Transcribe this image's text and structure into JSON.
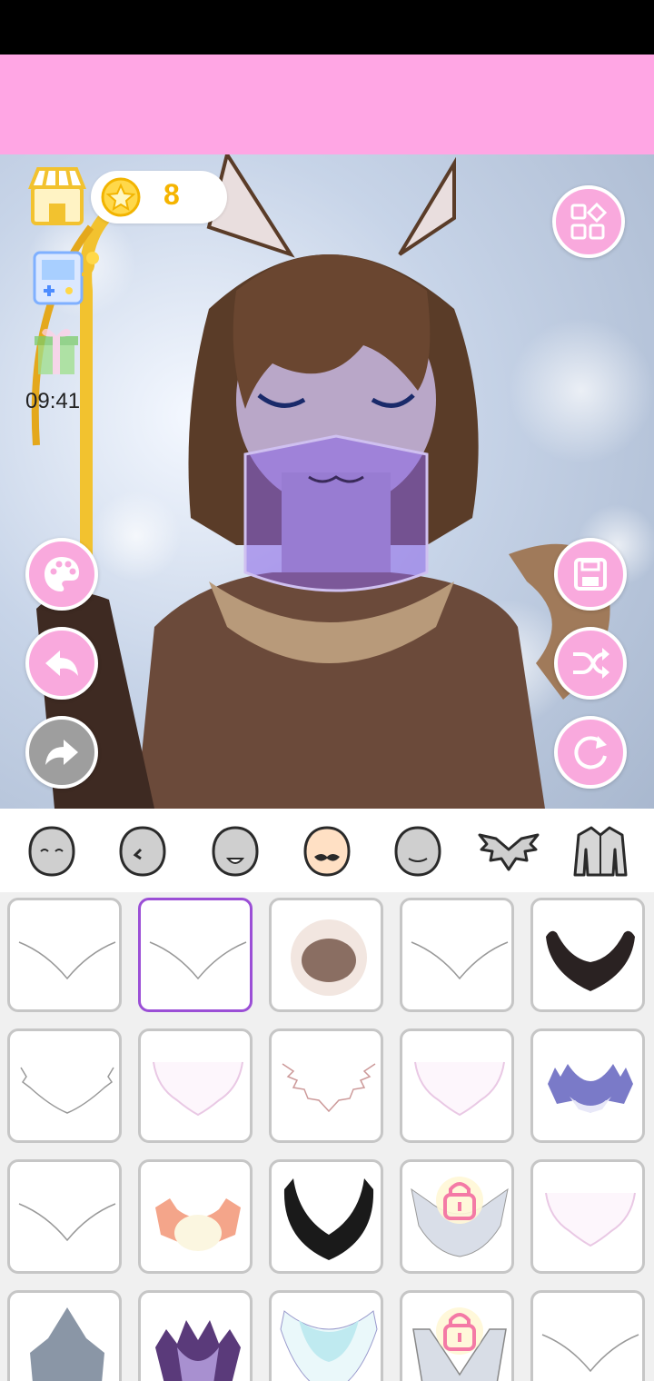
{
  "hud": {
    "coins": "8",
    "timer": "09:41"
  },
  "colors": {
    "banner": "#ffa6e4",
    "button_pink": "#f9a9dd",
    "button_disabled": "#9e9e9e",
    "selected_border": "#9b4fd6",
    "coin_text": "#f5b400"
  },
  "icons": {
    "shop": "shop-icon",
    "coin": "coin-icon",
    "game": "game-console-icon",
    "gift": "gift-icon",
    "menu": "grid-menu-icon",
    "palette": "palette-icon",
    "undo": "undo-icon",
    "redo": "redo-icon",
    "save": "save-icon",
    "shuffle": "shuffle-icon",
    "reset": "reset-icon"
  },
  "category_tabs": [
    {
      "id": "face",
      "icon": "face-icon",
      "selected": false
    },
    {
      "id": "ear",
      "icon": "ear-icon",
      "selected": false
    },
    {
      "id": "mouth",
      "icon": "mouth-icon",
      "selected": false
    },
    {
      "id": "mustache",
      "icon": "mustache-icon",
      "selected": true
    },
    {
      "id": "head",
      "icon": "head-icon",
      "selected": false
    },
    {
      "id": "fur-collar",
      "icon": "fur-collar-icon",
      "selected": false
    },
    {
      "id": "clothing",
      "icon": "jacket-icon",
      "selected": false
    }
  ],
  "items": [
    {
      "type": "outline",
      "locked": false,
      "selected": false
    },
    {
      "type": "outline",
      "locked": false,
      "selected": true
    },
    {
      "type": "brown-fluff",
      "locked": false,
      "selected": false
    },
    {
      "type": "outline",
      "locked": false,
      "selected": false
    },
    {
      "type": "black-fur",
      "locked": false,
      "selected": false
    },
    {
      "type": "outline-fluffy",
      "locked": false,
      "selected": false
    },
    {
      "type": "pink-outline",
      "locked": false,
      "selected": false
    },
    {
      "type": "outline-spiky",
      "locked": false,
      "selected": false
    },
    {
      "type": "pink-outline",
      "locked": false,
      "selected": false
    },
    {
      "type": "blue-fur",
      "locked": false,
      "selected": false
    },
    {
      "type": "outline",
      "locked": false,
      "selected": false
    },
    {
      "type": "orange-fur",
      "locked": false,
      "selected": false
    },
    {
      "type": "black-ring",
      "locked": false,
      "selected": false
    },
    {
      "type": "gray-hood",
      "locked": true,
      "selected": false
    },
    {
      "type": "pink-outline",
      "locked": false,
      "selected": false
    },
    {
      "type": "shark-hood",
      "locked": false,
      "selected": false
    },
    {
      "type": "purple-fur",
      "locked": false,
      "selected": false
    },
    {
      "type": "teal-collar",
      "locked": false,
      "selected": false
    },
    {
      "type": "white-collar",
      "locked": true,
      "selected": false
    },
    {
      "type": "outline",
      "locked": false,
      "selected": false
    }
  ]
}
